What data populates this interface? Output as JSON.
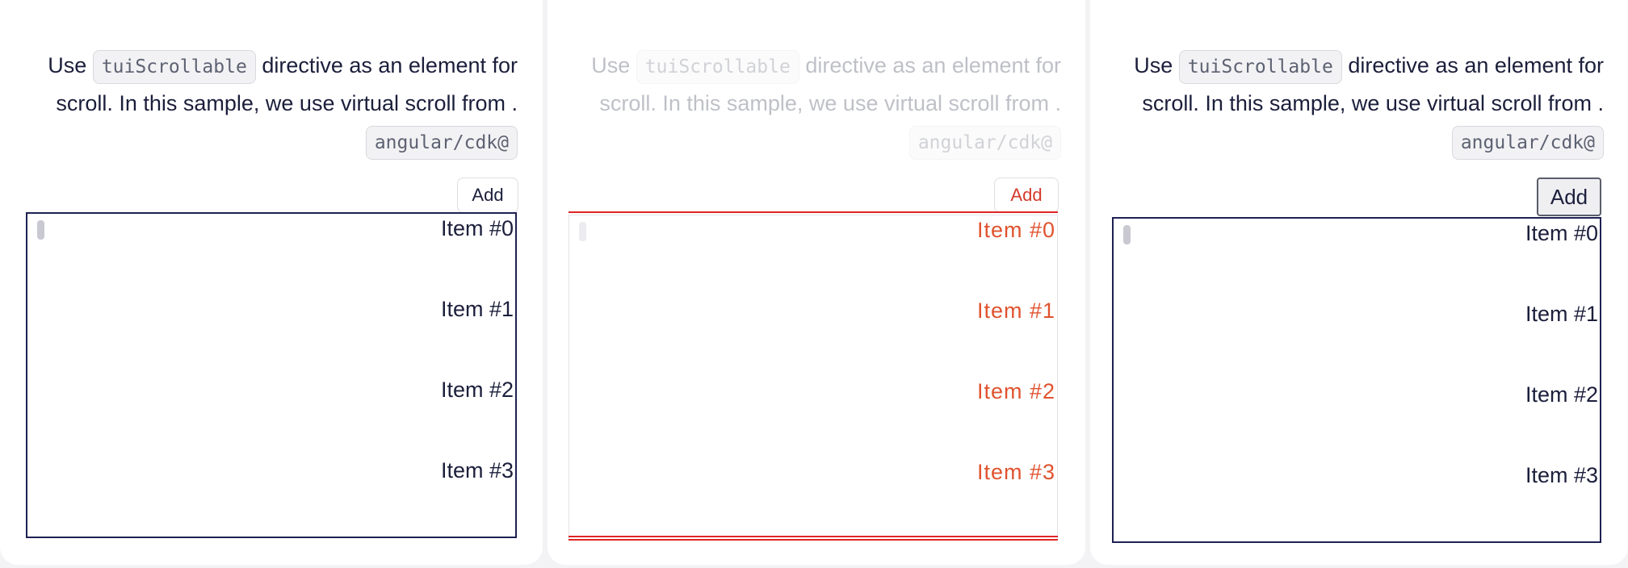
{
  "panels": [
    {
      "description": {
        "before": "Use ",
        "code1": "tuiScrollable",
        "middle": " directive as an element for scroll. In this sample, we use virtual scroll from . ",
        "code2": "angular/cdk@"
      },
      "add_label": "Add",
      "items": [
        "Item #0",
        "Item #1",
        "Item #2",
        "Item #3"
      ]
    },
    {
      "description": {
        "before": "Use ",
        "code1": "tuiScrollable",
        "middle": " directive as an element for scroll. In this sample, we use virtual scroll from . ",
        "code2": "angular/cdk@"
      },
      "add_label": "Add",
      "items": [
        "Item #0",
        "Item #1",
        "Item #2",
        "Item #3"
      ]
    },
    {
      "description": {
        "before": "Use ",
        "code1": "tuiScrollable",
        "middle": " directive as an element for scroll. In this sample, we use virtual scroll from . ",
        "code2": "angular/cdk@"
      },
      "add_label": "Add",
      "items": [
        "Item #0",
        "Item #1",
        "Item #2",
        "Item #3"
      ]
    }
  ],
  "colors": {
    "page_background": "#f3f3f5",
    "text": "#1b1f3b",
    "scroll_border": "#1e2152",
    "diff_highlight": "#e02424"
  }
}
